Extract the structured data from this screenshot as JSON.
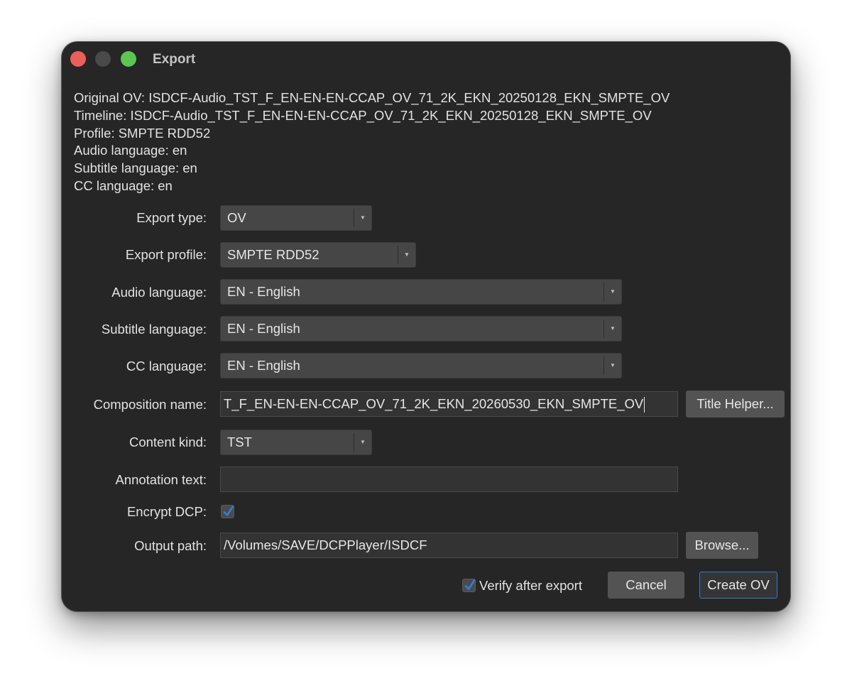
{
  "window": {
    "title": "Export"
  },
  "info": {
    "original_ov": "Original OV: ISDCF-Audio_TST_F_EN-EN-EN-CCAP_OV_71_2K_EKN_20250128_EKN_SMPTE_OV",
    "timeline": "Timeline: ISDCF-Audio_TST_F_EN-EN-EN-CCAP_OV_71_2K_EKN_20250128_EKN_SMPTE_OV",
    "profile": "Profile: SMPTE RDD52",
    "audio_language": "Audio language: en",
    "subtitle_language": "Subtitle language: en",
    "cc_language": "CC language: en"
  },
  "form": {
    "export_type": {
      "label": "Export type:",
      "value": "OV"
    },
    "export_profile": {
      "label": "Export profile:",
      "value": "SMPTE RDD52"
    },
    "audio_language": {
      "label": "Audio language:",
      "value": "EN - English"
    },
    "subtitle_language": {
      "label": "Subtitle language:",
      "value": "EN - English"
    },
    "cc_language": {
      "label": "CC language:",
      "value": "EN - English"
    },
    "composition_name": {
      "label": "Composition name:",
      "value": "T_F_EN-EN-EN-CCAP_OV_71_2K_EKN_20260530_EKN_SMPTE_OV",
      "helper_button": "Title Helper..."
    },
    "content_kind": {
      "label": "Content kind:",
      "value": "TST"
    },
    "annotation_text": {
      "label": "Annotation text:",
      "value": ""
    },
    "encrypt_dcp": {
      "label": "Encrypt DCP:",
      "checked": true
    },
    "output_path": {
      "label": "Output path:",
      "value": "/Volumes/SAVE/DCPPlayer/ISDCF",
      "browse_button": "Browse..."
    }
  },
  "footer": {
    "verify_label": "Verify after export",
    "verify_checked": true,
    "cancel_label": "Cancel",
    "create_label": "Create OV"
  },
  "colors": {
    "window_bg": "#262626",
    "accent": "#2f7ad8",
    "checkmark": "#2d7fe0"
  },
  "icons": {
    "combo_arrow": "chevron-down-icon",
    "checkmark": "checkmark-icon"
  }
}
